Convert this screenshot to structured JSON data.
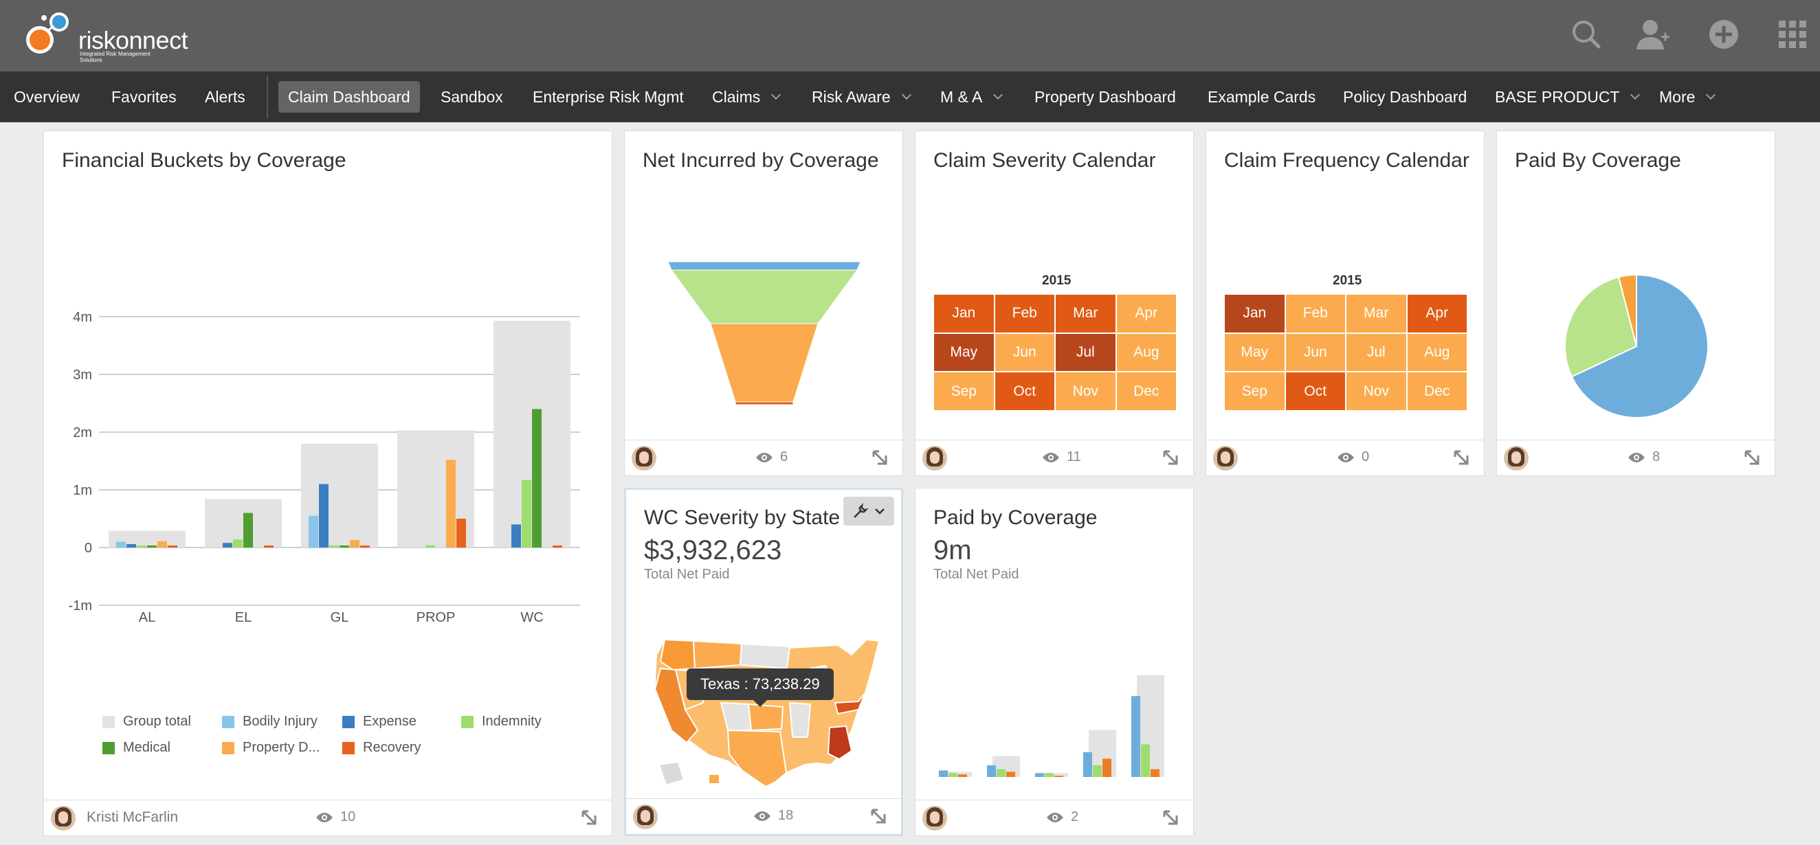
{
  "app": {
    "logo_text": "riskonnect",
    "logo_tagline": "Integrated Risk Management Solutions"
  },
  "topbar_icons": [
    "search-icon",
    "add-user-icon",
    "add-icon",
    "apps-grid-icon"
  ],
  "nav": {
    "items": [
      {
        "label": "Overview"
      },
      {
        "label": "Favorites"
      },
      {
        "label": "Alerts"
      },
      {
        "label": "Claim Dashboard",
        "active": true
      },
      {
        "label": "Sandbox"
      },
      {
        "label": "Enterprise Risk Mgmt"
      },
      {
        "label": "Claims",
        "dropdown": true
      },
      {
        "label": "Risk Aware",
        "dropdown": true
      },
      {
        "label": "M & A",
        "dropdown": true
      },
      {
        "label": "Property Dashboard"
      },
      {
        "label": "Example Cards"
      },
      {
        "label": "Policy Dashboard"
      },
      {
        "label": "BASE PRODUCT",
        "dropdown": true
      },
      {
        "label": "More",
        "dropdown": true
      }
    ]
  },
  "colors": {
    "group_total": "#e3e3e3",
    "bodily_injury": "#89c4ea",
    "expense": "#3a7fc1",
    "indemnity": "#9edc6e",
    "medical": "#4f9e32",
    "property_damage": "#fbab4e",
    "recovery": "#e8621e",
    "cal_light": "#fbab4e",
    "cal_mid": "#ef7c25",
    "cal_dark": "#e05a15",
    "cal_darkest": "#b8461c"
  },
  "cards": {
    "financial": {
      "title": "Financial Buckets by Coverage",
      "owner": "Kristi McFarlin",
      "views": "10"
    },
    "net_incurred": {
      "title": "Net Incurred by Coverage",
      "views": "6"
    },
    "severity_calendar": {
      "title": "Claim Severity Calendar",
      "views": "11",
      "year": "2015"
    },
    "frequency_calendar": {
      "title": "Claim Frequency Calendar",
      "views": "0",
      "year": "2015"
    },
    "paid_by_coverage_pie": {
      "title": "Paid By Coverage",
      "views": "8"
    },
    "wc_severity": {
      "title": "WC Severity by State of J",
      "value": "$3,932,623",
      "value_label": "Total Net Paid",
      "tooltip": "Texas : 73,238.29",
      "views": "18"
    },
    "paid_by_coverage_bars": {
      "title": "Paid by Coverage",
      "value": "9m",
      "value_label": "Total Net Paid",
      "views": "2"
    }
  },
  "chart_data": [
    {
      "type": "bar",
      "title": "Financial Buckets by Coverage",
      "categories": [
        "AL",
        "EL",
        "GL",
        "PROP",
        "WC"
      ],
      "yticks": [
        "4m",
        "3m",
        "2m",
        "1m",
        "0",
        "-1m"
      ],
      "ylim": [
        -1000000,
        4000000
      ],
      "legend_position": "bottom",
      "series": [
        {
          "name": "Group total",
          "values": [
            290000,
            840000,
            1800000,
            2030000,
            3930000
          ]
        },
        {
          "name": "Bodily Injury",
          "values": [
            100000,
            0,
            550000,
            0,
            0
          ]
        },
        {
          "name": "Expense",
          "values": [
            60000,
            80000,
            1100000,
            0,
            400000
          ]
        },
        {
          "name": "Indemnity",
          "values": [
            20000,
            140000,
            30000,
            40000,
            1170000
          ]
        },
        {
          "name": "Medical",
          "values": [
            20000,
            600000,
            20000,
            0,
            2400000
          ]
        },
        {
          "name": "Property D...",
          "values": [
            110000,
            0,
            130000,
            1520000,
            0
          ]
        },
        {
          "name": "Recovery",
          "values": [
            20000,
            20000,
            20000,
            500000,
            20000
          ]
        }
      ]
    },
    {
      "type": "funnel",
      "title": "Net Incurred by Coverage",
      "values": [
        120000,
        1100000,
        1300000,
        40000
      ]
    },
    {
      "type": "heatmap",
      "title": "Claim Severity Calendar",
      "year": "2015",
      "months": [
        "Jan",
        "Feb",
        "Mar",
        "Apr",
        "May",
        "Jun",
        "Jul",
        "Aug",
        "Sep",
        "Oct",
        "Nov",
        "Dec"
      ],
      "levels": [
        2,
        2,
        2,
        1,
        3,
        1,
        3,
        1,
        1,
        2,
        1,
        1
      ]
    },
    {
      "type": "heatmap",
      "title": "Claim Frequency Calendar",
      "year": "2015",
      "months": [
        "Jan",
        "Feb",
        "Mar",
        "Apr",
        "May",
        "Jun",
        "Jul",
        "Aug",
        "Sep",
        "Oct",
        "Nov",
        "Dec"
      ],
      "levels": [
        3,
        1,
        1,
        2,
        1,
        1,
        1,
        1,
        1,
        2,
        1,
        1
      ]
    },
    {
      "type": "pie",
      "title": "Paid By Coverage",
      "slices": [
        {
          "value": 68,
          "color": "#6daddc"
        },
        {
          "value": 28,
          "color": "#b7e38a"
        },
        {
          "value": 4,
          "color": "#f7a13d"
        }
      ]
    },
    {
      "type": "bar",
      "title": "Paid by Coverage",
      "groups": 5,
      "series": [
        {
          "color": "#e3e3e3",
          "values": [
            0.04,
            0.16,
            0.03,
            0.36,
            0.78
          ]
        },
        {
          "color": "#6daddc",
          "values": [
            0.05,
            0.09,
            0.03,
            0.19,
            0.62
          ]
        },
        {
          "color": "#9edc6e",
          "values": [
            0.03,
            0.06,
            0.03,
            0.09,
            0.25
          ]
        },
        {
          "color": "#ef7c25",
          "values": [
            0.02,
            0.04,
            0.01,
            0.14,
            0.06
          ]
        }
      ]
    }
  ]
}
